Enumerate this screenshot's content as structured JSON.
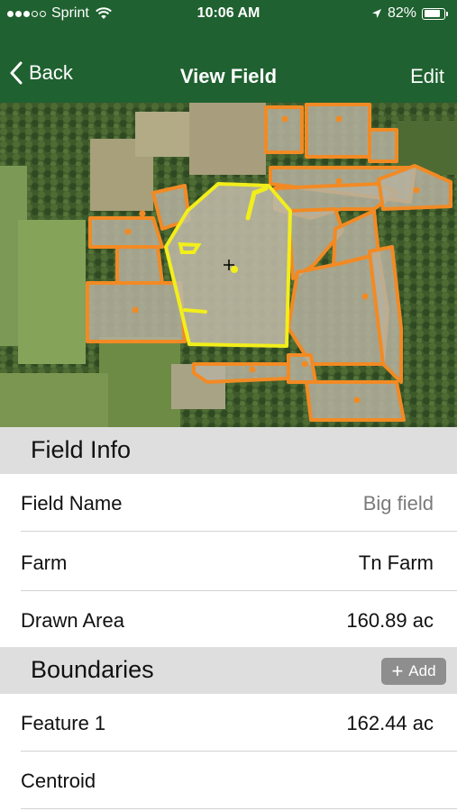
{
  "status_bar": {
    "carrier": "Sprint",
    "time": "10:06 AM",
    "battery": "82%",
    "battery_level": 0.82,
    "signal_bars_filled": 3,
    "signal_bars_total": 5
  },
  "nav": {
    "back_label": "Back",
    "title": "View Field",
    "edit_label": "Edit"
  },
  "field_info": {
    "title": "Field Info",
    "rows": [
      {
        "label": "Field Name",
        "value": "Big field"
      },
      {
        "label": "Farm",
        "value": "Tn Farm"
      },
      {
        "label": "Drawn Area",
        "value": "160.89 ac"
      }
    ]
  },
  "boundaries": {
    "title": "Boundaries",
    "add_label": "Add",
    "rows": [
      {
        "label": "Feature 1",
        "value": "162.44 ac"
      },
      {
        "label": "Centroid",
        "value": ""
      }
    ]
  },
  "colors": {
    "header_green": "#1f6130",
    "boundary_orange": "#f28a24",
    "selected_field_yellow": "#f2ee1b",
    "section_gray": "#dedede",
    "add_button_gray": "#8e8e8e"
  }
}
